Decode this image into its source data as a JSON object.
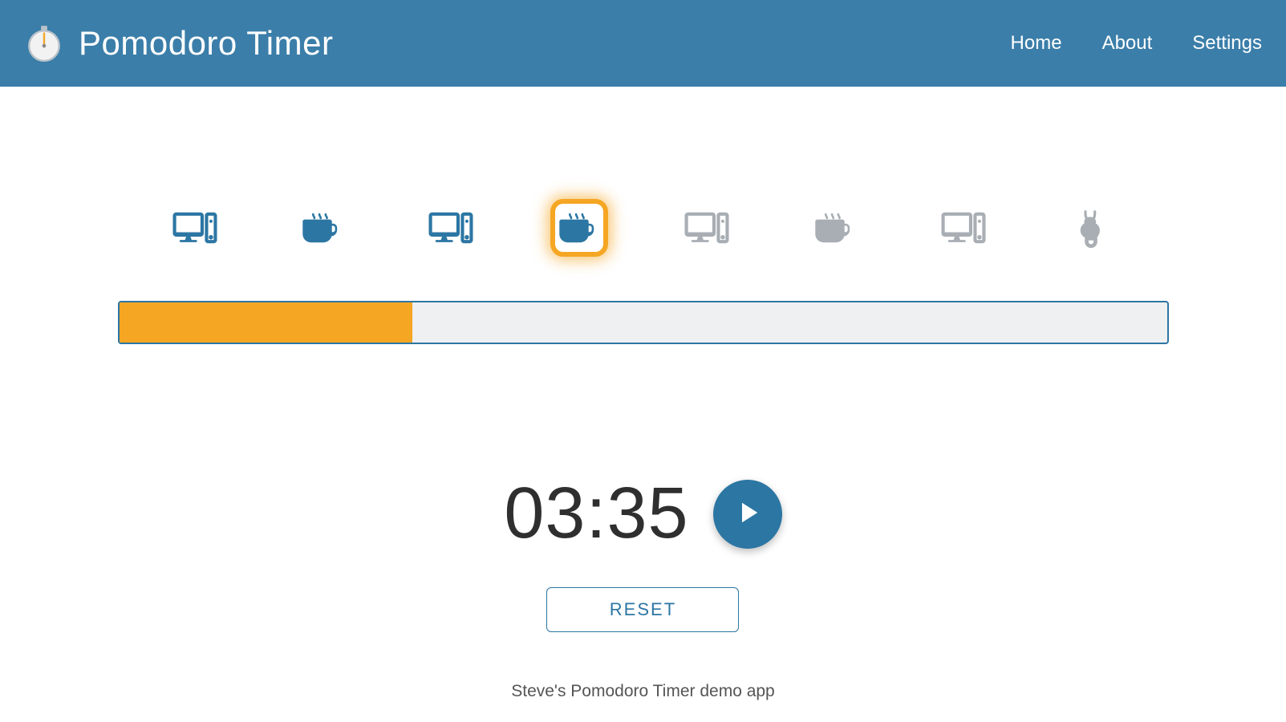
{
  "header": {
    "app_title": "Pomodoro Timer",
    "nav": {
      "home": "Home",
      "about": "About",
      "settings": "Settings"
    }
  },
  "phases": [
    {
      "type": "work",
      "state": "done"
    },
    {
      "type": "break",
      "state": "done"
    },
    {
      "type": "work",
      "state": "done"
    },
    {
      "type": "break",
      "state": "active"
    },
    {
      "type": "work",
      "state": "pending"
    },
    {
      "type": "break",
      "state": "pending"
    },
    {
      "type": "work",
      "state": "pending"
    },
    {
      "type": "long-break",
      "state": "pending"
    }
  ],
  "progress_percent": 28,
  "timer": {
    "time_display": "03:35",
    "reset_label": "RESET"
  },
  "footer": {
    "text": "Steve's Pomodoro Timer demo app"
  },
  "colors": {
    "header_bg": "#3b7ea9",
    "accent_blue": "#2c76a3",
    "accent_orange": "#f5a623",
    "pending_gray": "#a8aeb3"
  }
}
